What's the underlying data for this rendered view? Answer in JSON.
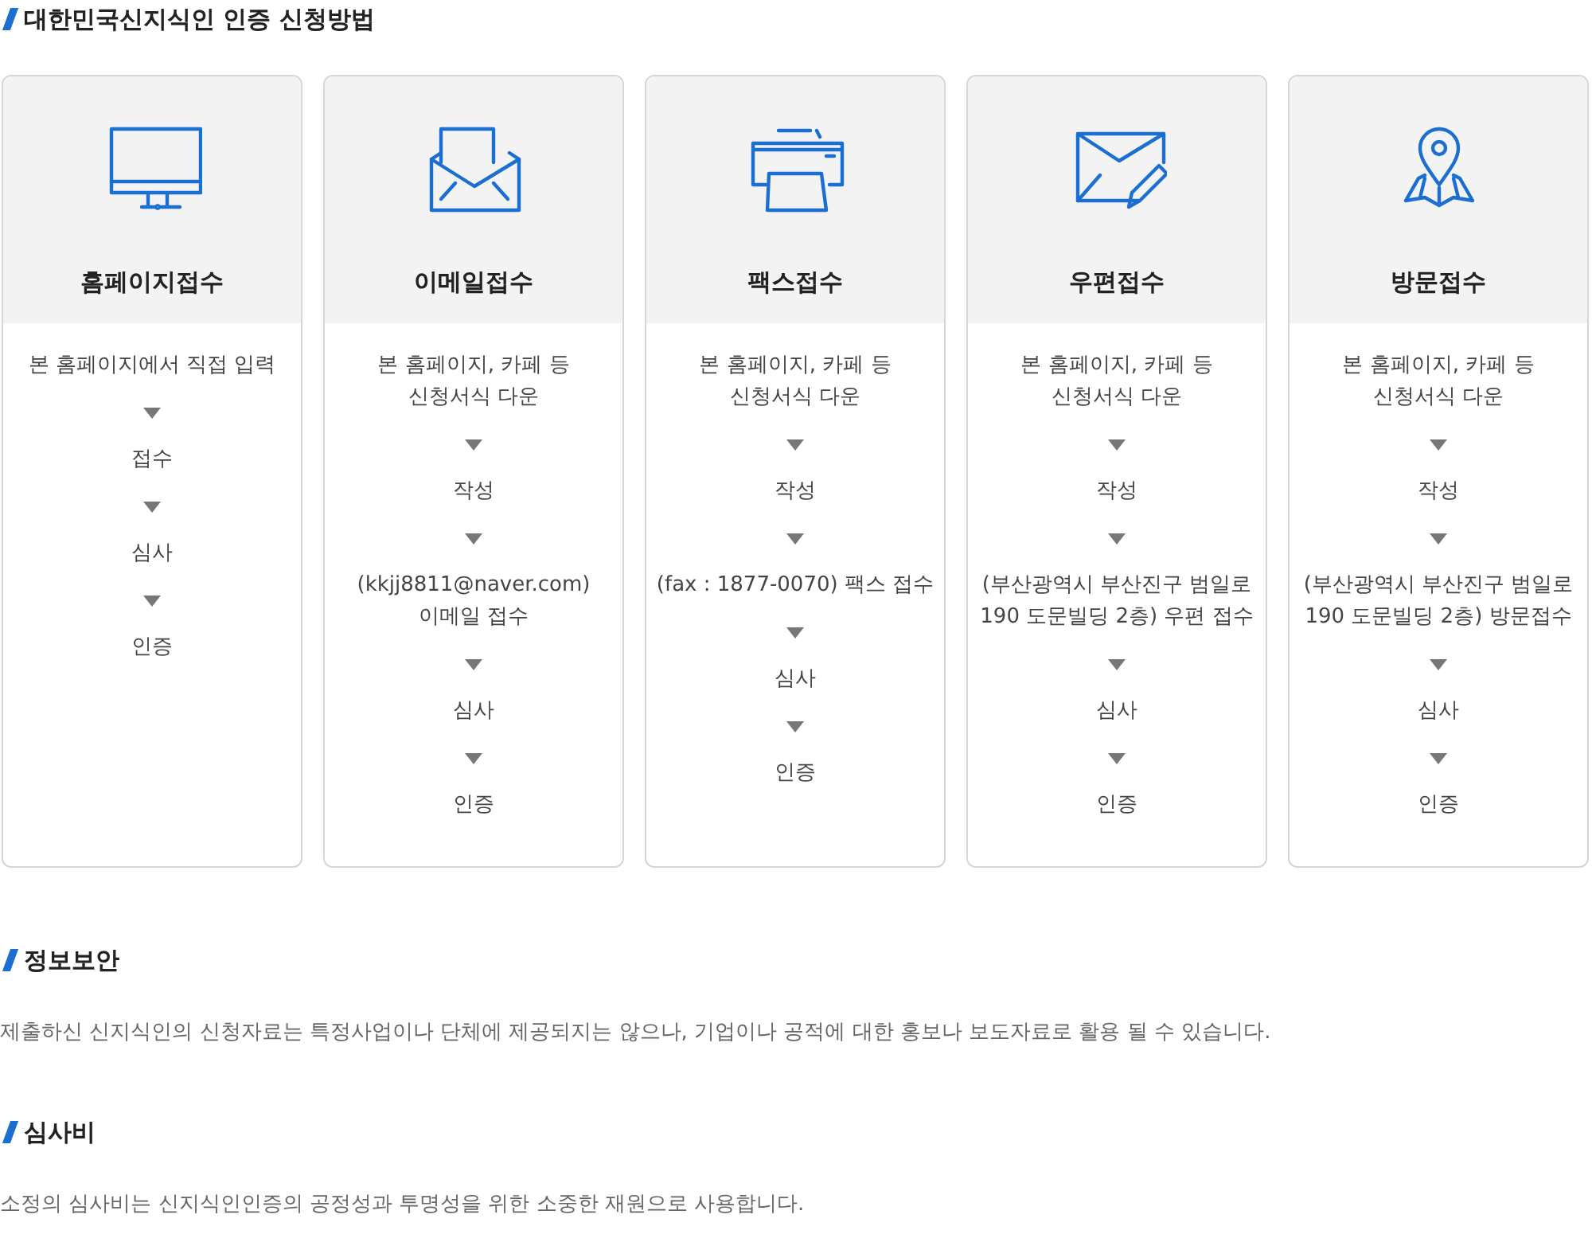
{
  "title": "대한민국신지식인 인증 신청방법",
  "methods": [
    {
      "kind": "web",
      "name": "홈페이지접수",
      "steps": [
        "본 홈페이지에서 직접 입력",
        "접수",
        "심사",
        "인증"
      ]
    },
    {
      "kind": "email",
      "name": "이메일접수",
      "steps": [
        "본 홈페이지, 카페 등\n신청서식 다운",
        "작성",
        "(kkjj8811@naver.com)\n이메일 접수",
        "심사",
        "인증"
      ]
    },
    {
      "kind": "fax",
      "name": "팩스접수",
      "steps": [
        "본 홈페이지, 카페 등\n신청서식 다운",
        "작성",
        "(fax : 1877-0070) 팩스 접수",
        "심사",
        "인증"
      ]
    },
    {
      "kind": "post",
      "name": "우편접수",
      "steps": [
        "본 홈페이지, 카페 등\n신청서식 다운",
        "작성",
        "(부산광역시 부산진구 범일로\n190 도문빌딩 2층) 우편 접수",
        "심사",
        "인증"
      ]
    },
    {
      "kind": "visit",
      "name": "방문접수",
      "steps": [
        "본 홈페이지, 카페 등\n신청서식 다운",
        "작성",
        "(부산광역시 부산진구 범일로\n190 도문빌딩 2층) 방문접수",
        "심사",
        "인증"
      ]
    }
  ],
  "sections": [
    {
      "heading": "정보보안",
      "text": "제출하신 신지식인의 신청자료는 특정사업이나 단체에 제공되지는 않으나, 기업이나 공적에 대한 홍보나 보도자료로 활용 될 수 있습니다."
    },
    {
      "heading": "심사비",
      "text": "소정의 심사비는 신지식인인증의 공정성과 투명성을 위한 소중한 재원으로 사용합니다."
    }
  ]
}
